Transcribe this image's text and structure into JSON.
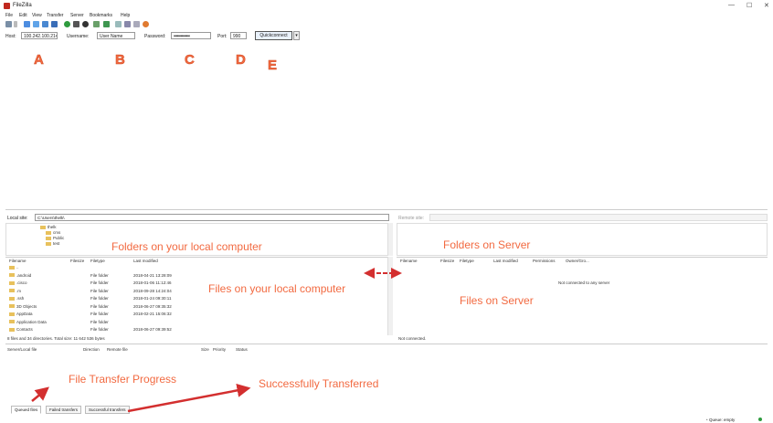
{
  "window": {
    "title": "FileZilla",
    "minimize": "—",
    "maximize": "☐",
    "close": "✕"
  },
  "menu": [
    "File",
    "Edit",
    "View",
    "Transfer",
    "Server",
    "Bookmarks",
    "Help"
  ],
  "toolbar": {
    "icons": [
      "site-manager-icon",
      "dropdown-icon",
      "message-log-icon",
      "local-tree-icon",
      "remote-tree-icon",
      "transfer-queue-icon",
      "refresh-icon",
      "process-queue-icon",
      "cancel-icon",
      "disconnect-icon",
      "reconnect-icon",
      "filter-icon",
      "compare-icon",
      "sync-browse-icon",
      "search-icon"
    ]
  },
  "quickconnect": {
    "host_label": "Host:",
    "host_value": "100.242.100.214",
    "username_label": "Username:",
    "username_value": "User Name",
    "password_label": "Password:",
    "password_value": "••••••••••••••",
    "port_label": "Port:",
    "port_value": "990",
    "button_label": "Quickconnect",
    "dropdown": "▾"
  },
  "annotation_letters": {
    "a": "A",
    "b": "B",
    "c": "C",
    "d": "D",
    "e": "E"
  },
  "local": {
    "site_label": "Local site:",
    "site_value": "C:\\Users\\thelk\\",
    "tree": [
      {
        "label": "thelk",
        "indent": 0
      },
      {
        "label": "cms",
        "indent": 1
      },
      {
        "label": "Public",
        "indent": 1
      },
      {
        "label": "test",
        "indent": 1
      }
    ],
    "headers": {
      "filename": "Filename",
      "filesize": "Filesize",
      "filetype": "Filetype",
      "modified": "Last modified"
    },
    "files": [
      {
        "name": "..",
        "type": "",
        "modified": ""
      },
      {
        "name": ".android",
        "type": "File folder",
        "modified": "2018-04-21 13:28:09"
      },
      {
        "name": ".cisco",
        "type": "File folder",
        "modified": "2018-01-06 11:12:46"
      },
      {
        "name": ".m",
        "type": "File folder",
        "modified": "2018-09-28 14:24:04"
      },
      {
        "name": ".ssh",
        "type": "File folder",
        "modified": "2018-01-24 09:30:11"
      },
      {
        "name": "3D Objects",
        "type": "File folder",
        "modified": "2018-06-27 09:35:32"
      },
      {
        "name": "AppData",
        "type": "File folder",
        "modified": "2018-02-21 15:06:32"
      },
      {
        "name": "Application Data",
        "type": "File folder",
        "modified": ""
      },
      {
        "name": "Contacts",
        "type": "File folder",
        "modified": "2018-06-27 09:39:52"
      }
    ],
    "status": "8 files and 34 directories. Total size: 11 642 536 bytes"
  },
  "remote": {
    "site_label": "Remote site:",
    "headers": {
      "filename": "Filename",
      "filesize": "Filesize",
      "filetype": "Filetype",
      "modified": "Last modified",
      "permissions": "Permissions",
      "owner": "Owner/Gro..."
    },
    "empty_message": "Not connected to any server",
    "status": "Not connected."
  },
  "queue": {
    "headers": {
      "server": "Server/Local file",
      "direction": "Direction",
      "remote": "Remote file",
      "size": "Size",
      "priority": "Priority",
      "status": "Status"
    },
    "tabs": [
      "Queued files",
      "Failed transfers",
      "Successful transfers"
    ],
    "status_right": "Queue: empty"
  },
  "annotations": {
    "local_folders": "Folders on your local computer",
    "server_folders": "Folders on Server",
    "local_files": "Files on your local computer",
    "server_files": "Files on Server",
    "progress": "File Transfer Progress",
    "success": "Successfully Transferred"
  },
  "colors": {
    "annotation": "#f26a41",
    "arrow": "#d32f2f",
    "accent": "#3a7bd5"
  }
}
